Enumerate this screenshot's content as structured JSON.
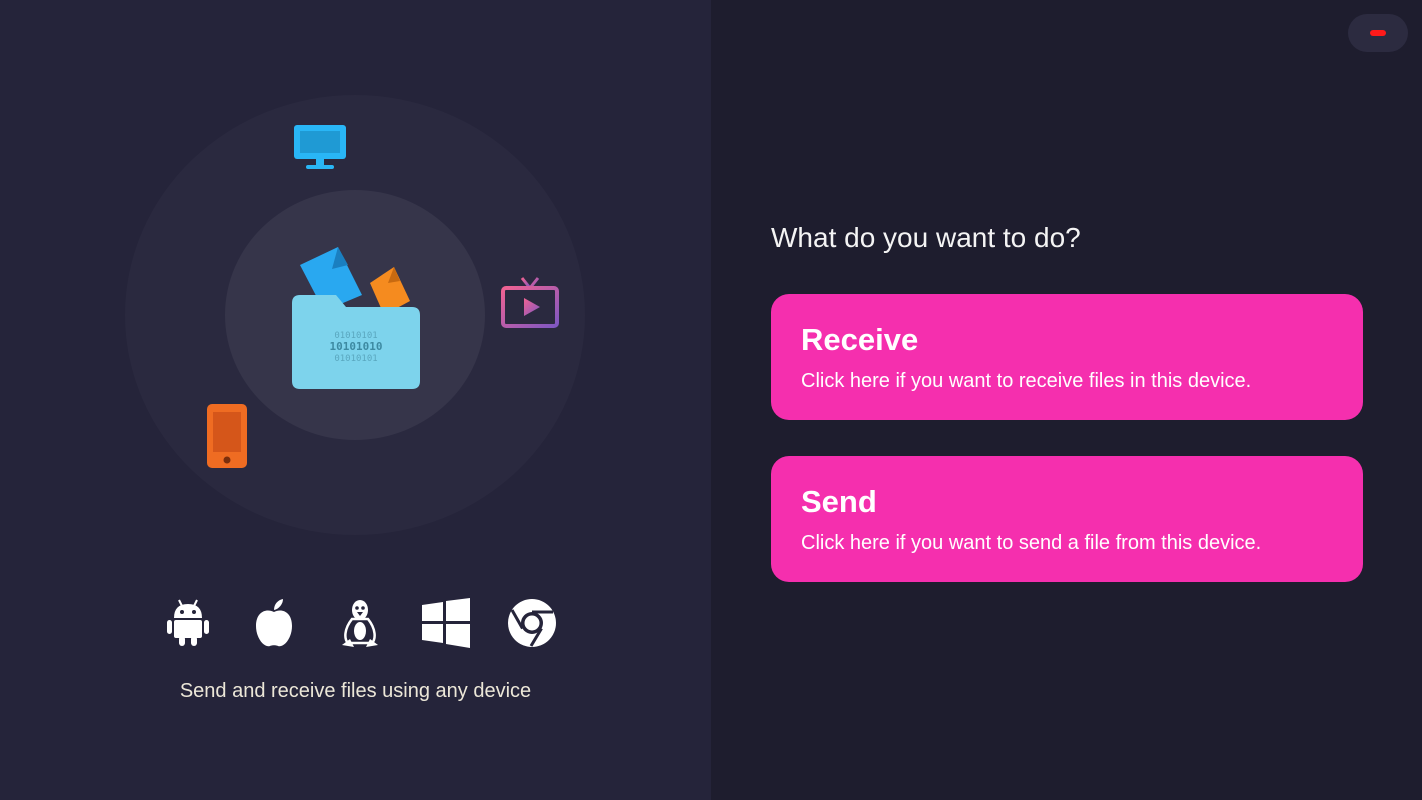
{
  "colors": {
    "left_bg": "#25243a",
    "right_bg": "#1e1d2e",
    "accent": "#f52fae",
    "minimize": "#ff1a1a"
  },
  "left": {
    "floating_icons": [
      "monitor-icon",
      "tv-icon",
      "smartphone-icon"
    ],
    "center_icon": "folder-icon",
    "folder_binary": [
      "01010101",
      "10101010",
      "01010101"
    ],
    "platforms": [
      "android-icon",
      "apple-icon",
      "linux-icon",
      "windows-icon",
      "chrome-icon"
    ],
    "tagline": "Send and receive files using any device"
  },
  "right": {
    "prompt": "What do you want to do?",
    "actions": [
      {
        "title": "Receive",
        "description": "Click here if you want to receive files in this device."
      },
      {
        "title": "Send",
        "description": "Click here if you want to send a file from this device."
      }
    ]
  },
  "window": {
    "control": "minimize-icon"
  }
}
